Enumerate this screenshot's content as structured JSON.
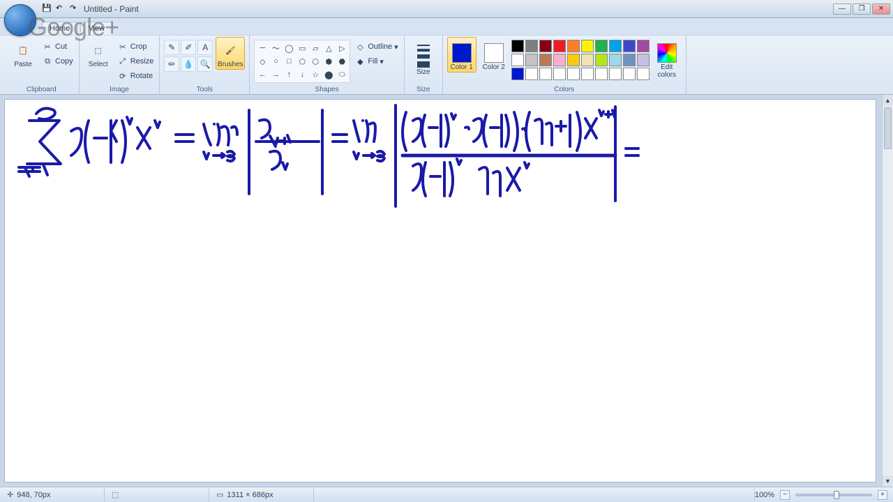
{
  "window": {
    "title": "Untitled - Paint",
    "watermark": "Google+",
    "controls": {
      "minimize": "—",
      "maximize": "❐",
      "close": "✕"
    },
    "qat": {
      "save": "💾",
      "undo": "↶",
      "redo": "↷"
    }
  },
  "tabs": {
    "home": "Home",
    "view": "View"
  },
  "ribbon": {
    "clipboard": {
      "label": "Clipboard",
      "paste": "Paste",
      "cut": "Cut",
      "copy": "Copy"
    },
    "image": {
      "label": "Image",
      "select": "Select",
      "crop": "Crop",
      "resize": "Resize",
      "rotate": "Rotate"
    },
    "tools": {
      "label": "Tools",
      "items": [
        "✎",
        "✐",
        "A",
        "✏",
        "💧",
        "🔍"
      ],
      "brushes": "Brushes"
    },
    "shapes": {
      "label": "Shapes",
      "outline": "Outline",
      "fill": "Fill",
      "icons": [
        "─",
        "〜",
        "◯",
        "▭",
        "▱",
        "△",
        "▷",
        "◇",
        "○",
        "□",
        "⬠",
        "⬡",
        "⬢",
        "⬣",
        "←",
        "→",
        "↑",
        "↓",
        "☆",
        "⬤",
        "⬭"
      ]
    },
    "size": {
      "label": "Size",
      "btn": "Size"
    },
    "colors": {
      "label": "Colors",
      "color1": "Color\n1",
      "color2": "Color\n2",
      "edit": "Edit\ncolors",
      "active_color1": "#0018cc",
      "active_color2": "#ffffff",
      "palette_row1": [
        "#000000",
        "#7f7f7f",
        "#880015",
        "#ed1c24",
        "#ff7f27",
        "#fff200",
        "#22b14c",
        "#00a2e8",
        "#3f48cc",
        "#a349a4"
      ],
      "palette_row2": [
        "#ffffff",
        "#c3c3c3",
        "#b97a57",
        "#ffaec9",
        "#ffc90e",
        "#efe4b0",
        "#b5e61d",
        "#99d9ea",
        "#7092be",
        "#c8bfe7"
      ],
      "palette_row3": [
        "#0018cc",
        "#ffffff",
        "#ffffff",
        "#ffffff",
        "#ffffff",
        "#ffffff",
        "#ffffff",
        "#ffffff",
        "#ffffff",
        "#ffffff"
      ]
    }
  },
  "status": {
    "cursor_pos": "948, 70px",
    "selection": "",
    "canvas_size": "1311 × 686px",
    "zoom": "100%",
    "zoom_minus": "−",
    "zoom_plus": "+"
  },
  "canvas": {
    "description": "Handwritten mathematical derivation in blue ink showing ratio test for series ∑ 9(-1)^n x^n from n=1 to ∞, expressed as lim(n→∞) |a_{n+1}/a_n| = lim(n→∞) |(9(-1)^n · 9(-1)) · (n+1)x^{n+1} / (9(-1)^n n x^n)| ="
  }
}
